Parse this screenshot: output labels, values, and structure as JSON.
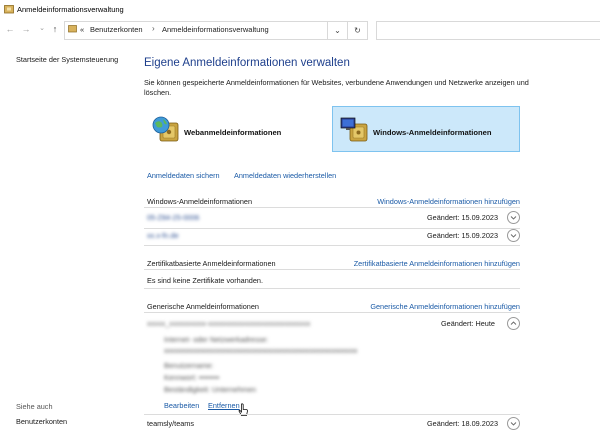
{
  "window": {
    "title": "Anmeldeinformationsverwaltung"
  },
  "address": {
    "prefix": "«",
    "crumbs": [
      "Benutzerkonten",
      "Anmeldeinformationsverwaltung"
    ],
    "separator": "›",
    "dropdown_glyph": "⌄",
    "refresh_glyph": "↻"
  },
  "nav": {
    "back": "←",
    "forward": "→",
    "recent": "⌄",
    "up": "↑"
  },
  "left": {
    "home": "Startseite der Systemsteuerung",
    "see_also": "Siehe auch",
    "accounts": "Benutzerkonten"
  },
  "main": {
    "heading": "Eigene Anmeldeinformationen verwalten",
    "description": "Sie können gespeicherte Anmeldeinformationen für Websites, verbundene Anwendungen und Netzwerke anzeigen und löschen.",
    "tile_web": "Webanmeldeinformationen",
    "tile_windows": "Windows-Anmeldeinformationen",
    "backup": "Anmeldedaten sichern",
    "restore": "Anmeldedaten wiederherstellen"
  },
  "windows_section": {
    "title": "Windows-Anmeldeinformationen",
    "add": "Windows-Anmeldeinformationen hinzufügen",
    "items": [
      {
        "name": "05-Z84-25-0006",
        "changed": "Geändert:  15.09.2023"
      },
      {
        "name": "xx.x-fn.de",
        "changed": "Geändert:  15.09.2023"
      }
    ]
  },
  "cert_section": {
    "title": "Zertifikatbasierte Anmeldeinformationen",
    "add": "Zertifikatbasierte Anmeldeinformationen hinzufügen",
    "empty": "Es sind keine Zertifikate vorhanden."
  },
  "generic_section": {
    "title": "Generische Anmeldeinformationen",
    "add": "Generische Anmeldeinformationen hinzufügen",
    "expanded": {
      "name": "xxxxx_xxxxxxxxxx-xxxxxxxxxxxxxxxxxxxxxxxxxxxx",
      "changed": "Geändert:  Heute",
      "details": [
        "Internet- oder Netzwerkadresse:",
        "xxxxxxxxxxxxxxxxxxxxxxxxxxxxxxxxxxxxxxxxxxxxxxxxxxxxx",
        "Benutzername:",
        "Kennwort: ••••••••",
        "Beständigkeit: Unternehmen"
      ],
      "edit": "Bearbeiten",
      "remove": "Entfernen"
    },
    "last": {
      "name": "teamsly/teams",
      "changed": "Geändert:  18.09.2023"
    }
  },
  "colors": {
    "heading": "#1e3f8c",
    "link": "#1a5aa6",
    "selected_tile": "#cce8fa",
    "selected_tile_border": "#7ec3ef"
  },
  "icons": [
    "folder-icon",
    "globe-safe-icon",
    "windows-safe-icon",
    "chevron-down-icon",
    "chevron-up-icon",
    "mouse-pointer-icon"
  ]
}
